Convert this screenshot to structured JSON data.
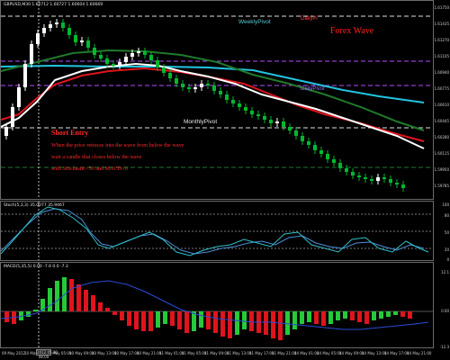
{
  "chart": {
    "symbol_header": "GBPUSD,M30 1.60712 1.60727 1.60604 1.60669",
    "title": "Forex Wave",
    "pivots": {
      "weekly": "WeeklyPivot",
      "daily_top": "DailyPi",
      "daily_mid": "DailyPivot",
      "monthly": "MonthlyPivot"
    },
    "annotation": {
      "heading": "Short Entry",
      "line1": "When the price retraces into the wave from below the wave",
      "line2": "wait a candle that closes below the wave",
      "line3": "with Stochastic<50 and MACD<0"
    }
  },
  "stoch": {
    "header": "Stoch(5,3,3) 35.0077 35.9467"
  },
  "macd": {
    "header": "MACD(5,35,5) 0.00 -7.6 0.0 -7.3"
  },
  "price_axis": [
    "1.61750",
    "1.61435",
    "1.61270",
    "1.61105",
    "1.60940",
    "1.60775",
    "1.60610",
    "1.60445",
    "1.60280",
    "1.60115",
    "1.59950",
    "1.59785"
  ],
  "stoch_axis": [
    "100",
    "80",
    "50",
    "20",
    "0"
  ],
  "macd_axis": [
    "12.1",
    "0.00",
    "-12.3"
  ],
  "time_axis": [
    "09 May 2012",
    "10 May 01:00",
    "10 May 05:00",
    "10 May 09:00",
    "10 May 13:00",
    "10 May 17:00",
    "10 May 21:00",
    "11 May 01:00",
    "11 May 05:00",
    "11 May 09:00",
    "11 May 13:00",
    "11 May 17:00",
    "11 May 21:00",
    "14 May 01:00",
    "14 May 05:00",
    "14 May 09:00",
    "14 May 13:00",
    "14 May 17:00",
    "14 May 21:00"
  ],
  "cursor_date": "2012.05.10 08:00",
  "colors": {
    "background": "#000000",
    "weekly_pivot": "#5bc8d6",
    "daily_pivot": "#b44dff",
    "monthly_pivot": "#e0e0e0",
    "daily_pivot_top": "#ff3a3a",
    "ema_fast": "#ffffff",
    "ema_mid": "#e0141c",
    "ema_slow": "#1e7a2a",
    "ema_cyan": "#22c4e0",
    "bull": "#ffffff",
    "bear": "#00b82e",
    "macd_up": "#26c93a",
    "macd_down": "#e0141c"
  }
}
